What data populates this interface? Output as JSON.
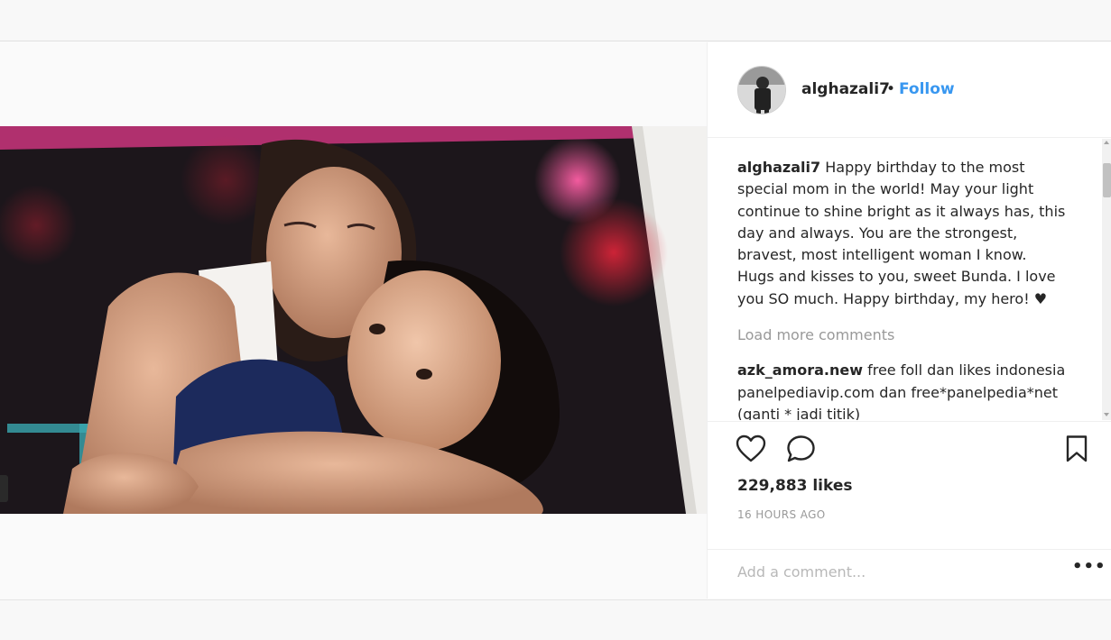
{
  "post": {
    "username": "alghazali7",
    "separator": "•",
    "follow_label": "Follow",
    "caption": {
      "user": "alghazali7",
      "text": "Happy birthday to the most special mom in the world! May your light continue to shine bright as it always has, this day and always. You are the strongest, bravest, most intelligent woman I know. Hugs and kisses to you, sweet Bunda. I love you SO much. Happy birthday, my hero! ♥"
    },
    "load_more": "Load more comments",
    "comments": [
      {
        "user": "azk_amora.new",
        "text": "free foll dan likes indonesia panelpediavip.com dan free*panelpedia*net (ganti * jadi titik)"
      }
    ],
    "likes": "229,883 likes",
    "time": "16 HOURS AGO",
    "add_comment_placeholder": "Add a comment...",
    "more_label": "•••"
  },
  "icons": {
    "like": "heart-icon",
    "comment": "comment-icon",
    "save": "bookmark-icon",
    "more": "more-options-icon"
  },
  "colors": {
    "follow": "#3897f0",
    "text": "#262626",
    "muted": "#999999"
  }
}
